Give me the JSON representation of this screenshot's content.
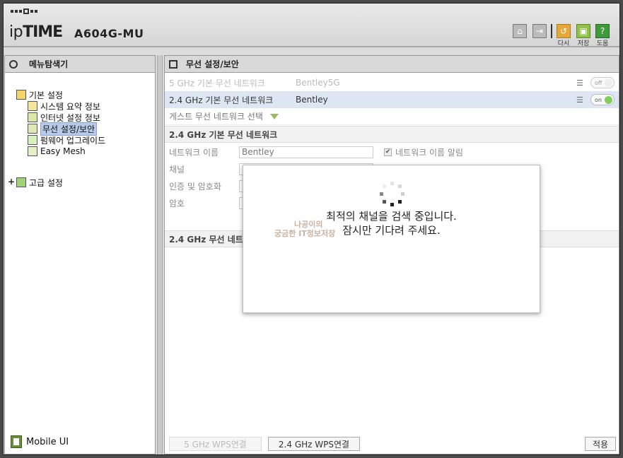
{
  "header": {
    "brand_prefix": "ip",
    "brand_main": "TIME",
    "model": "A604G-MU",
    "buttons": [
      {
        "id": "home",
        "label": "",
        "icon": "home-icon"
      },
      {
        "id": "logout",
        "label": "",
        "icon": "logout-icon"
      },
      {
        "id": "reload",
        "label": "다시",
        "icon": "reload-icon",
        "color": "#e7a83a"
      },
      {
        "id": "save",
        "label": "저장",
        "icon": "save-icon",
        "color": "#8fc04a"
      },
      {
        "id": "help",
        "label": "도움",
        "icon": "help-icon",
        "color": "#3e9a3a"
      }
    ]
  },
  "left": {
    "title": "메뉴탐색기",
    "tree": [
      {
        "label": "기본 설정",
        "level": 0,
        "icon": "folder-icon"
      },
      {
        "label": "시스템 요약 정보",
        "level": 1,
        "icon": "chart-icon"
      },
      {
        "label": "인터넷 설정 정보",
        "level": 1,
        "icon": "monitor-icon"
      },
      {
        "label": "무선 설정/보안",
        "level": 1,
        "icon": "wifi-icon",
        "selected": true
      },
      {
        "label": "펌웨어 업그레이드",
        "level": 1,
        "icon": "upgrade-icon"
      },
      {
        "label": "Easy Mesh",
        "level": 1,
        "icon": "mesh-icon"
      },
      {
        "label": "고급 설정",
        "level": 0,
        "icon": "folder-icon",
        "expander": "+"
      }
    ],
    "mobile_label": "Mobile UI"
  },
  "right": {
    "title": "무선 설정/보안",
    "net5": {
      "label": "5 GHz 기본 무선 네트워크",
      "value": "Bentley5G",
      "toggle": "off"
    },
    "net24": {
      "label": "2.4 GHz 기본 무선 네트워크",
      "value": "Bentley",
      "toggle": "on"
    },
    "guest": {
      "label": "게스트 무선 네트워크 선택"
    },
    "section1": "2.4 GHz 기본 무선 네트워크",
    "fields": {
      "name_label": "네트워크 이름",
      "name_value": "Bentley",
      "broadcast_label": "네트워크 이름 알림",
      "channel_label": "채널",
      "auth_label": "인증 및 암호화",
      "password_label": "암호"
    },
    "section2": "2.4 GHz 무선 네트워",
    "buttons": {
      "wps5": "5 GHz WPS연결",
      "wps24": "2.4 GHz WPS연결",
      "apply": "적용"
    }
  },
  "modal": {
    "line1": "최적의 채널을 검색 중입니다.",
    "line2": "잠시만 기다려 주세요.",
    "watermark1": "나공이의",
    "watermark2": "궁금한 IT정보저장"
  }
}
